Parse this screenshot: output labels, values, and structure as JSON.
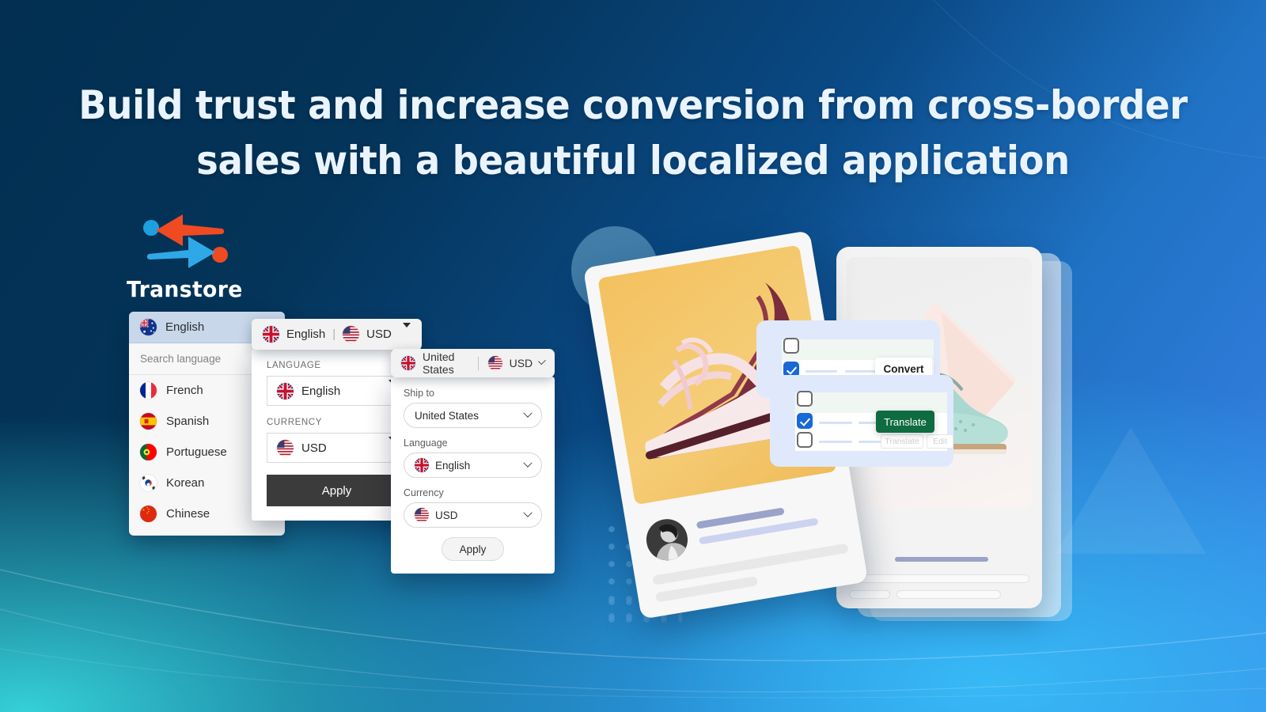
{
  "headline": {
    "line1": "Build trust and increase conversion from cross-border",
    "line2": "sales with a beautiful localized application"
  },
  "logo": {
    "name": "Transtore",
    "arrow_left_color": "#f04a23",
    "arrow_right_color": "#2fa8e8",
    "dot_blue": "#1e9fe0",
    "dot_red": "#f04a23"
  },
  "colors": {
    "background_dark": "#032f52",
    "background_blue": "#1f72c4",
    "background_cyan": "#35d0d8",
    "accent_blue": "#1868d6",
    "translate_green": "#0f6b40",
    "apply_dark": "#3b3b3b"
  },
  "language_panel": {
    "current_label": "English",
    "current_flag": "flag-australia",
    "search_placeholder": "Search language",
    "items": [
      {
        "label": "French",
        "flag": "flag-france"
      },
      {
        "label": "Spanish",
        "flag": "flag-spain"
      },
      {
        "label": "Portuguese",
        "flag": "flag-portugal"
      },
      {
        "label": "Korean",
        "flag": "flag-south-korea"
      },
      {
        "label": "Chinese",
        "flag": "flag-china"
      }
    ]
  },
  "selector_panel": {
    "header_language": "English",
    "header_separator": "|",
    "header_currency": "USD",
    "header_language_flag": "flag-united-kingdom",
    "header_currency_flag": "flag-united-states",
    "language_label": "LANGUAGE",
    "language_value": "English",
    "language_flag": "flag-united-kingdom",
    "currency_label": "CURRENCY",
    "currency_value": "USD",
    "currency_flag": "flag-united-states",
    "apply_label": "Apply"
  },
  "shipping_panel": {
    "header_country": "United States",
    "header_currency": "USD",
    "header_country_flag": "flag-united-kingdom",
    "header_currency_flag": "flag-united-states",
    "ship_to_label": "Ship to",
    "ship_to_value": "United States",
    "language_label": "Language",
    "language_value": "English",
    "language_flag": "flag-united-kingdom",
    "currency_label": "Currency",
    "currency_value": "USD",
    "currency_flag": "flag-united-states",
    "apply_label": "Apply"
  },
  "illustration": {
    "convert_button": "Convert",
    "translate_button": "Translate",
    "ghost_translate_button": "Translate",
    "ghost_edit_button": "Edit"
  }
}
